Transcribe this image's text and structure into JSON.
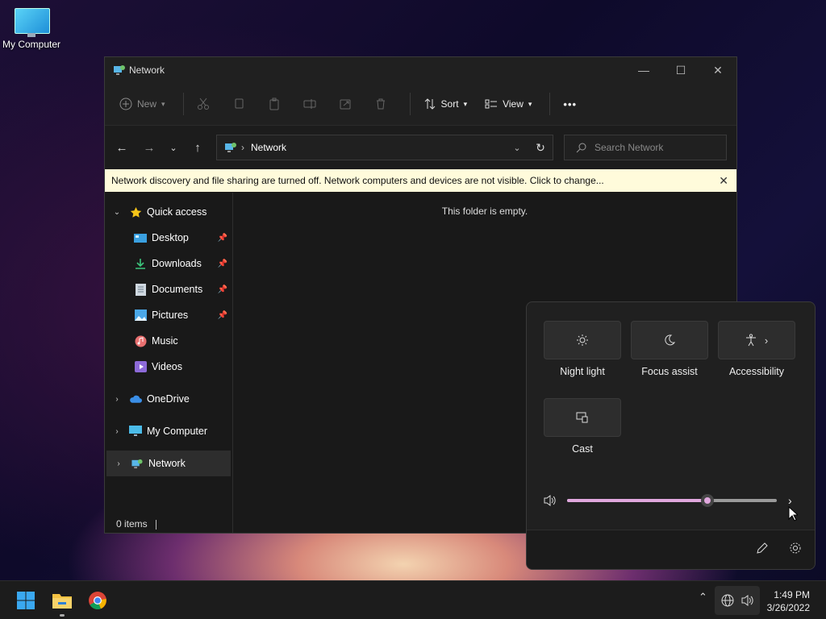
{
  "desktop": {
    "icons": [
      {
        "label": "My Computer",
        "icon": "monitor-icon"
      }
    ]
  },
  "explorer": {
    "title": "Network",
    "window_controls": {
      "minimize": "—",
      "maximize": "☐",
      "close": "✕"
    },
    "commandbar": {
      "new_label": "New",
      "sort_label": "Sort",
      "view_label": "View",
      "more_label": "•••"
    },
    "address": {
      "path": "Network"
    },
    "search": {
      "placeholder": "Search Network"
    },
    "infobar": {
      "message": "Network discovery and file sharing are turned off. Network computers and devices are not visible. Click to change..."
    },
    "navpane": {
      "quick_access": "Quick access",
      "quick_items": [
        {
          "label": "Desktop",
          "pinned": true,
          "icon": "desktop-icon"
        },
        {
          "label": "Downloads",
          "pinned": true,
          "icon": "download-icon"
        },
        {
          "label": "Documents",
          "pinned": true,
          "icon": "document-icon"
        },
        {
          "label": "Pictures",
          "pinned": true,
          "icon": "picture-icon"
        },
        {
          "label": "Music",
          "pinned": false,
          "icon": "music-icon"
        },
        {
          "label": "Videos",
          "pinned": false,
          "icon": "video-icon"
        }
      ],
      "onedrive": "OneDrive",
      "my_computer": "My Computer",
      "network": "Network"
    },
    "empty_text": "This folder is empty.",
    "status": "0 items"
  },
  "quick_settings": {
    "tiles": [
      {
        "label": "Night light",
        "icon": "brightness-icon"
      },
      {
        "label": "Focus assist",
        "icon": "moon-icon"
      },
      {
        "label": "Accessibility",
        "icon": "accessibility-icon"
      },
      {
        "label": "Cast",
        "icon": "cast-icon"
      }
    ],
    "volume": {
      "level": 0.67,
      "fill_color": "#e0a7dd"
    }
  },
  "taskbar": {
    "clock": {
      "time": "1:49 PM",
      "date": "3/26/2022"
    },
    "apps": [
      "start-button",
      "file-explorer",
      "chrome"
    ]
  }
}
